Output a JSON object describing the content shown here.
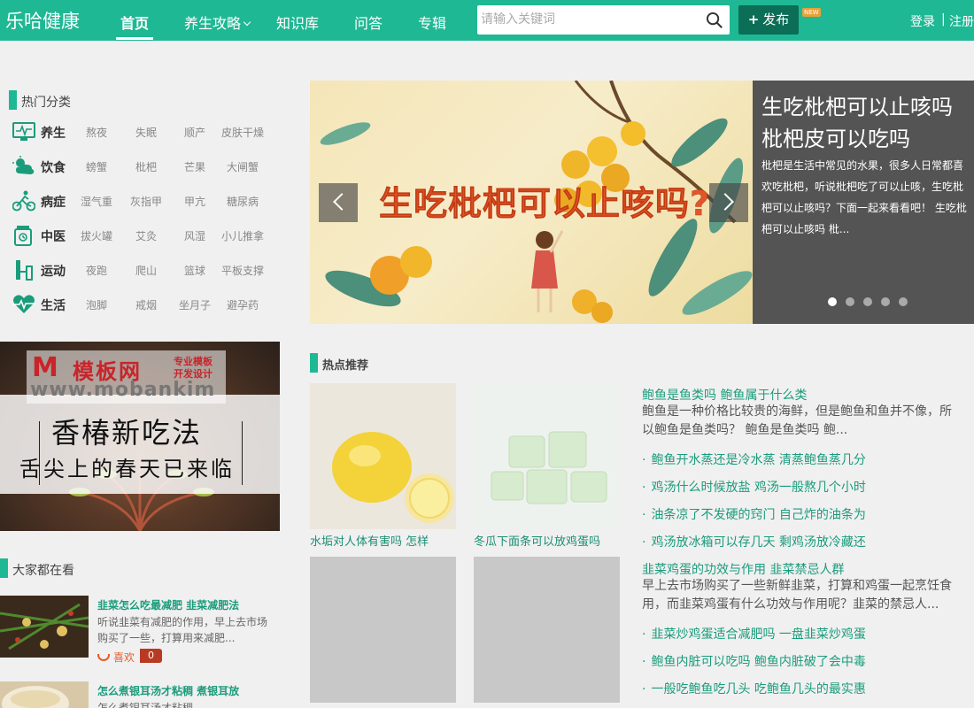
{
  "header": {
    "logo": "乐哈健康",
    "nav": [
      {
        "label": "首页",
        "active": true
      },
      {
        "label": "养生攻略",
        "dropdown": true
      },
      {
        "label": "知识库"
      },
      {
        "label": "问答"
      },
      {
        "label": "专辑"
      }
    ],
    "search_placeholder": "请输入关键词",
    "publish_label": "发布",
    "new_badge": "NEW",
    "login": "登录",
    "separator": "|",
    "register": "注册"
  },
  "hot_categories": {
    "title": "热门分类",
    "rows": [
      {
        "name": "养生",
        "icon": "monitor-heart-icon",
        "tags": [
          "熬夜",
          "失眠",
          "顺产",
          "皮肤干燥"
        ]
      },
      {
        "name": "饮食",
        "icon": "weather-cloud-icon",
        "tags": [
          "螃蟹",
          "枇杷",
          "芒果",
          "大闸蟹"
        ]
      },
      {
        "name": "病症",
        "icon": "cyclist-icon",
        "tags": [
          "湿气重",
          "灰指甲",
          "甲亢",
          "糖尿病"
        ]
      },
      {
        "name": "中医",
        "icon": "medicine-jar-icon",
        "tags": [
          "拔火罐",
          "艾灸",
          "风湿",
          "小儿推拿"
        ]
      },
      {
        "name": "运动",
        "icon": "dumbbell-icon",
        "tags": [
          "夜跑",
          "爬山",
          "篮球",
          "平板支撑"
        ]
      },
      {
        "name": "生活",
        "icon": "heartbeat-icon",
        "tags": [
          "泡脚",
          "戒烟",
          "坐月子",
          "避孕药"
        ]
      }
    ]
  },
  "slider": {
    "image_text": "生吃枇杷可以止咳吗?",
    "title": "生吃枇杷可以止咳吗 枇杷皮可以吃吗",
    "description": "枇杷是生活中常见的水果，很多人日常都喜欢吃枇杷，听说枇杷吃了可以止咳，生吃枇杷可以止咳吗？下面一起来看看吧！ 生吃枇杷可以止咳吗 枇...",
    "dots": 5,
    "active_dot": 0
  },
  "ad": {
    "logo_m": "M",
    "logo_text": "模板网",
    "tagline_1": "专业模板",
    "tagline_2": "开发设计",
    "www": "www.mobankim",
    "line1": "香椿新吃法",
    "line2": "舌尖上的春天已来临"
  },
  "hot_recommend": {
    "title": "热点推荐",
    "cards": [
      {
        "caption": "水垢对人体有害吗 怎样"
      },
      {
        "caption": "冬瓜下面条可以放鸡蛋吗"
      },
      {
        "caption": ""
      },
      {
        "caption": ""
      }
    ],
    "news_blocks": [
      {
        "headline": "鲍鱼是鱼类吗 鲍鱼属于什么类",
        "desc": "鲍鱼是一种价格比较贵的海鲜，但是鲍鱼和鱼并不像，所以鲍鱼是鱼类吗？ 鲍鱼是鱼类吗 鲍...",
        "items": [
          "鲍鱼开水蒸还是冷水蒸 清蒸鲍鱼蒸几分",
          "鸡汤什么时候放盐 鸡汤一般熬几个小时",
          "油条凉了不发硬的窍门 自己炸的油条为",
          "鸡汤放冰箱可以存几天 剩鸡汤放冷藏还"
        ]
      },
      {
        "headline": "韭菜鸡蛋的功效与作用 韭菜禁忌人群",
        "desc": "早上去市场购买了一些新鲜韭菜，打算和鸡蛋一起烹饪食用，而韭菜鸡蛋有什么功效与作用呢？韭菜的禁忌人...",
        "items": [
          "韭菜炒鸡蛋适合减肥吗 一盘韭菜炒鸡蛋",
          "鲍鱼内脏可以吃吗 鲍鱼内脏破了会中毒",
          "一般吃鲍鱼吃几头 吃鲍鱼几头的最实惠"
        ]
      }
    ]
  },
  "everyone_watching": {
    "title": "大家都在看",
    "items": [
      {
        "title": "韭菜怎么吃最减肥 韭菜减肥法",
        "desc": "听说韭菜有减肥的作用，早上去市场购买了一些，打算用来减肥...",
        "like_label": "喜欢",
        "like_count": "0"
      },
      {
        "title": "怎么煮银耳汤才粘稠 煮银耳放",
        "desc": "怎么煮银耳汤才粘稠",
        "like_label": "",
        "like_count": ""
      }
    ]
  },
  "colors": {
    "brand": "#1fb894",
    "brand_dark": "#0c6e56",
    "link": "#1a9c7c",
    "accent": "#e8a23a"
  }
}
